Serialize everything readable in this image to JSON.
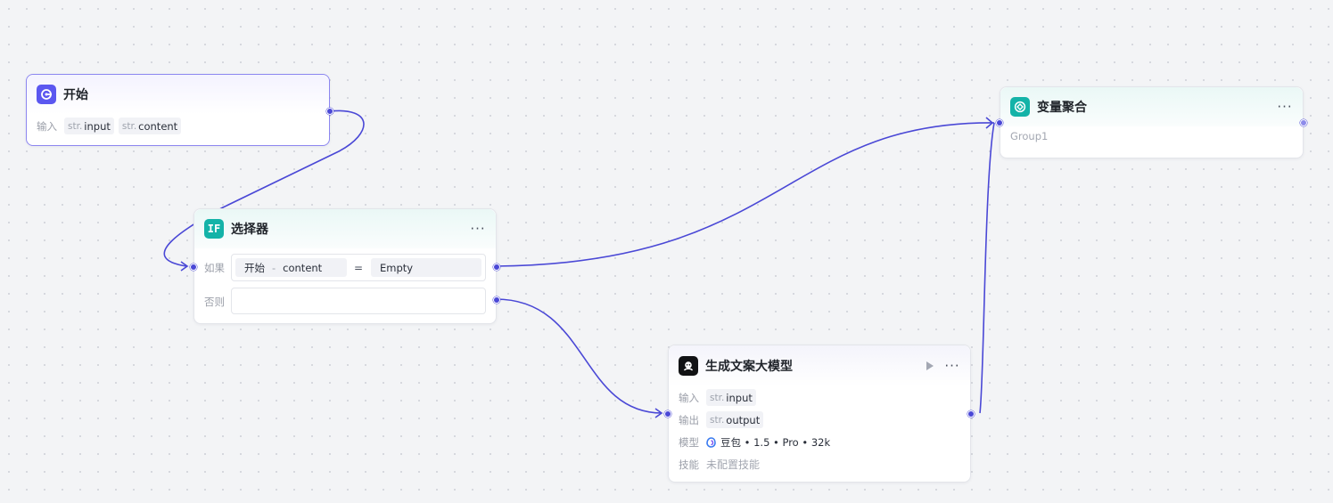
{
  "canvas": {
    "background": "#f3f4f6",
    "edge_color": "#4a48d6",
    "accent": "#5b57f0",
    "teal": "#14b3a8"
  },
  "start_node": {
    "title": "开始",
    "icon": "start-icon",
    "input_label": "输入",
    "inputs": [
      {
        "type": "str.",
        "name": "input"
      },
      {
        "type": "str.",
        "name": "content"
      }
    ]
  },
  "selector_node": {
    "title": "选择器",
    "icon": "if-icon",
    "icon_text": "IF",
    "if_label": "如果",
    "else_label": "否则",
    "condition": {
      "source": "开始",
      "separator": "-",
      "variable": "content",
      "operator": "=",
      "value": "Empty"
    },
    "more": "···"
  },
  "aggregator_node": {
    "title": "变量聚合",
    "icon": "aggregate-icon",
    "group": "Group1",
    "more": "···"
  },
  "llm_node": {
    "title": "生成文案大模型",
    "icon": "llm-icon",
    "input_label": "输入",
    "input": {
      "type": "str.",
      "name": "input"
    },
    "output_label": "输出",
    "output": {
      "type": "str.",
      "name": "output"
    },
    "model_label": "模型",
    "model": "豆包 • 1.5 • Pro • 32k",
    "skill_label": "技能",
    "skill": "未配置技能",
    "more": "···"
  }
}
